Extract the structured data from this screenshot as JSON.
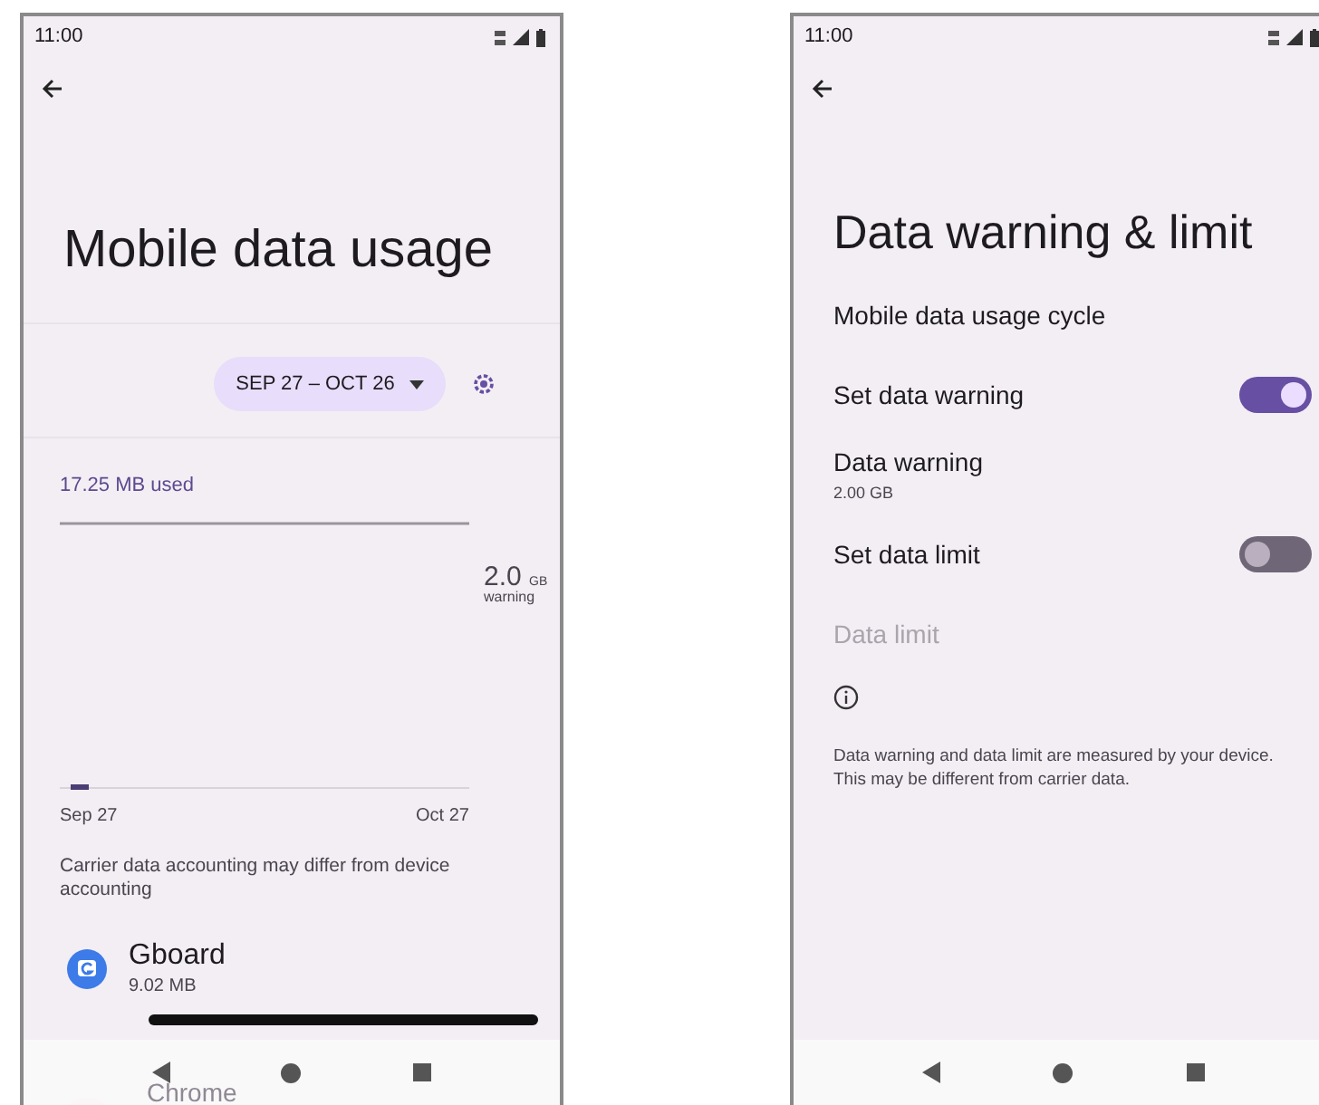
{
  "usage_screen": {
    "status_bar": {
      "time": "11:00"
    },
    "title": "Mobile data usage",
    "cycle_button": "SEP 27 – OCT 26",
    "used": "17.25 MB used",
    "warning": {
      "value": "2.0",
      "unit": "GB",
      "label": "warning"
    },
    "axis_start": "Sep 27",
    "axis_end": "Oct 27",
    "note": "Carrier data accounting may differ from device accounting",
    "apps": [
      {
        "name": "Gboard",
        "usage": "9.02 MB",
        "level": 1
      },
      {
        "name": "Chrome"
      }
    ]
  },
  "warning_screen": {
    "status_bar": {
      "time": "11:00"
    },
    "title": "Data warning & limit",
    "items": [
      {
        "kind": "item",
        "label": "Mobile data usage cycle",
        "disabled": false
      },
      {
        "kind": "switch",
        "label": "Set data warning",
        "on": true
      },
      {
        "kind": "item",
        "label": "Data warning",
        "summary": "2.00 GB",
        "disabled": false
      },
      {
        "kind": "switch",
        "label": "Set data limit",
        "on": false
      },
      {
        "kind": "item",
        "label": "Data limit",
        "disabled": true
      }
    ],
    "note": "Data warning and data limit are measured by your device. This may be different from carrier data."
  }
}
